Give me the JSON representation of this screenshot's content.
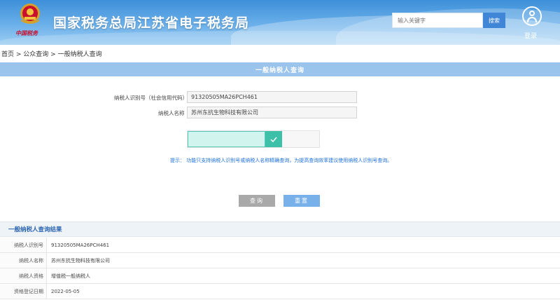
{
  "header": {
    "site_title": "国家税务总局江苏省电子税务局",
    "emblem_text": "中国税务",
    "search_placeholder": "输入关键字",
    "search_button": "搜索",
    "login_label": "登录"
  },
  "breadcrumb": {
    "home": "首页",
    "sep1": " > ",
    "public_query": "公众查询",
    "sep2": " > ",
    "current": "一般纳税人查询"
  },
  "section_title": "一般纳税人查询",
  "form": {
    "taxpayer_id_label": "纳税人识别号（社会信用代码）",
    "taxpayer_id_value": "91320505MA26PCH461",
    "taxpayer_name_label": "纳税人名称",
    "taxpayer_name_value": "苏州东抗生物科技有限公司",
    "tip": "提示：   功能只支持纳税人识别号或纳税人名称精确查询，为提高查询效率建议使用纳税人识别号查询。",
    "query_button": "查询",
    "reset_button": "重置"
  },
  "colors": {
    "header_blue": "#3d8fd8",
    "section_bar": "#9ac4ec",
    "captcha_green": "#3dc0a8",
    "reset_button": "#78b1ea",
    "query_button": "#a9a9a9",
    "tip_blue": "#1b6fd8"
  },
  "results": {
    "title": "一般纳税人查询结果",
    "rows": [
      {
        "key": "纳税人识别号",
        "value": "91320505MA26PCH461"
      },
      {
        "key": "纳税人名称",
        "value": "苏州东抗生物科技有限公司"
      },
      {
        "key": "纳税人资格",
        "value": "增值税一般纳税人"
      },
      {
        "key": "资格登记日期",
        "value": "2022-05-05"
      }
    ]
  },
  "icons": {
    "search": "search-icon",
    "user": "user-icon",
    "check": "check-icon",
    "emblem": "tax-emblem-icon"
  }
}
